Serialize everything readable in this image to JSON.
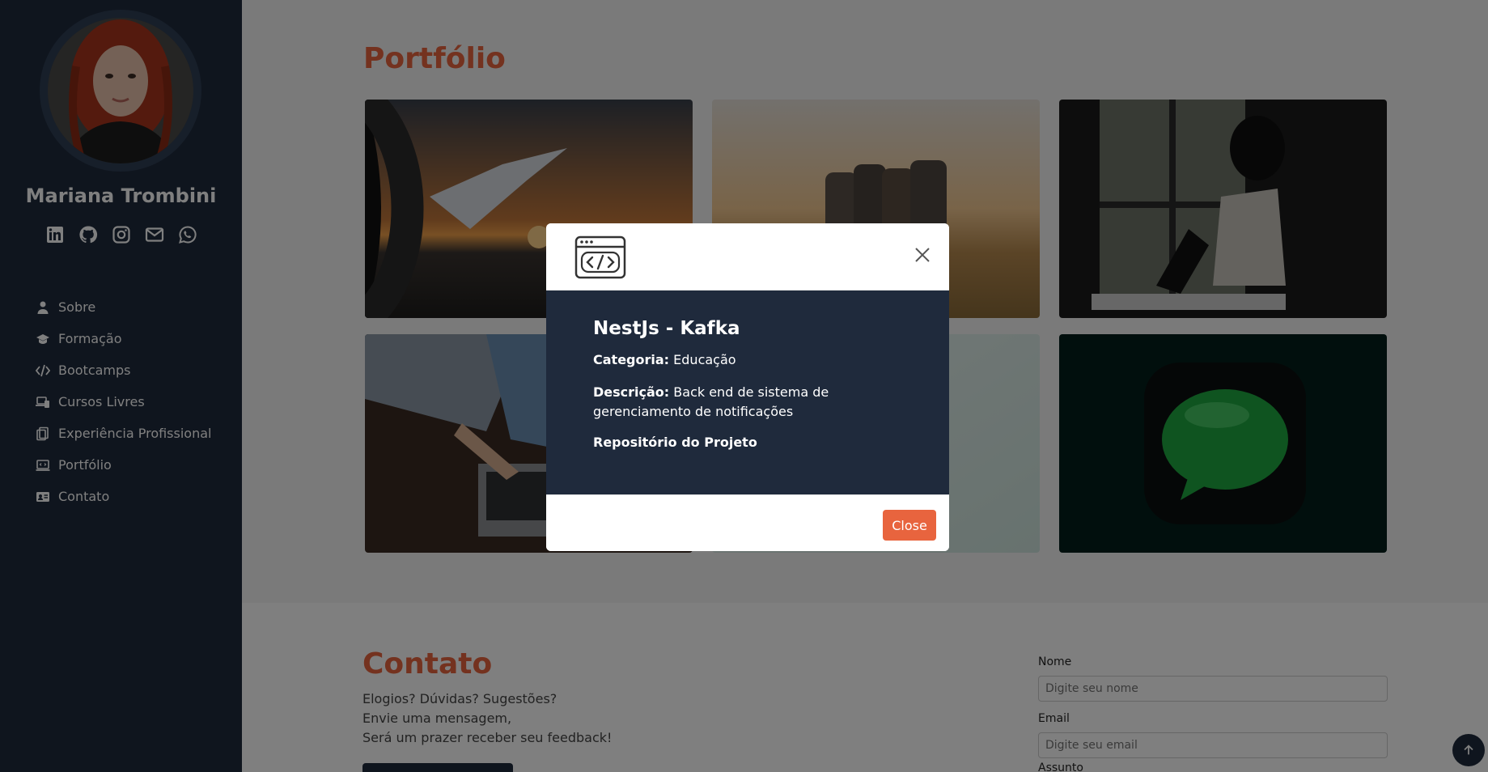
{
  "sidebar": {
    "name": "Mariana Trombini",
    "socials": [
      "linkedin-icon",
      "github-icon",
      "instagram-icon",
      "envelope-icon",
      "whatsapp-icon"
    ],
    "nav": [
      {
        "label": "Sobre",
        "icon": "user-icon"
      },
      {
        "label": "Formação",
        "icon": "graduation-cap-icon"
      },
      {
        "label": "Bootcamps",
        "icon": "code-icon"
      },
      {
        "label": "Cursos Livres",
        "icon": "laptop-icon"
      },
      {
        "label": "Experiência Profissional",
        "icon": "briefcase-icon"
      },
      {
        "label": "Portfólio",
        "icon": "monitor-code-icon"
      },
      {
        "label": "Contato",
        "icon": "id-card-icon"
      }
    ]
  },
  "portfolio": {
    "title": "Portfólio"
  },
  "contact": {
    "title": "Contato",
    "lines": [
      "Elogios? Dúvidas? Sugestões?",
      "Envie uma mensagem,",
      "Será um prazer receber seu feedback!"
    ],
    "name_label": "Nome",
    "name_placeholder": "Digite seu nome",
    "email_label": "Email",
    "email_placeholder": "Digite seu email",
    "subject_label": "Assunto"
  },
  "modal": {
    "title": "NestJs - Kafka",
    "category_label": "Categoria:",
    "category_value": "Educação",
    "description_label": "Descrição:",
    "description_value": "Back end de sistema de gerenciamento de notificações",
    "repo_link": "Repositório do Projeto",
    "close_label": "Close"
  },
  "colors": {
    "sidebar_bg": "#1f2a3c",
    "accent": "#e8643e"
  }
}
